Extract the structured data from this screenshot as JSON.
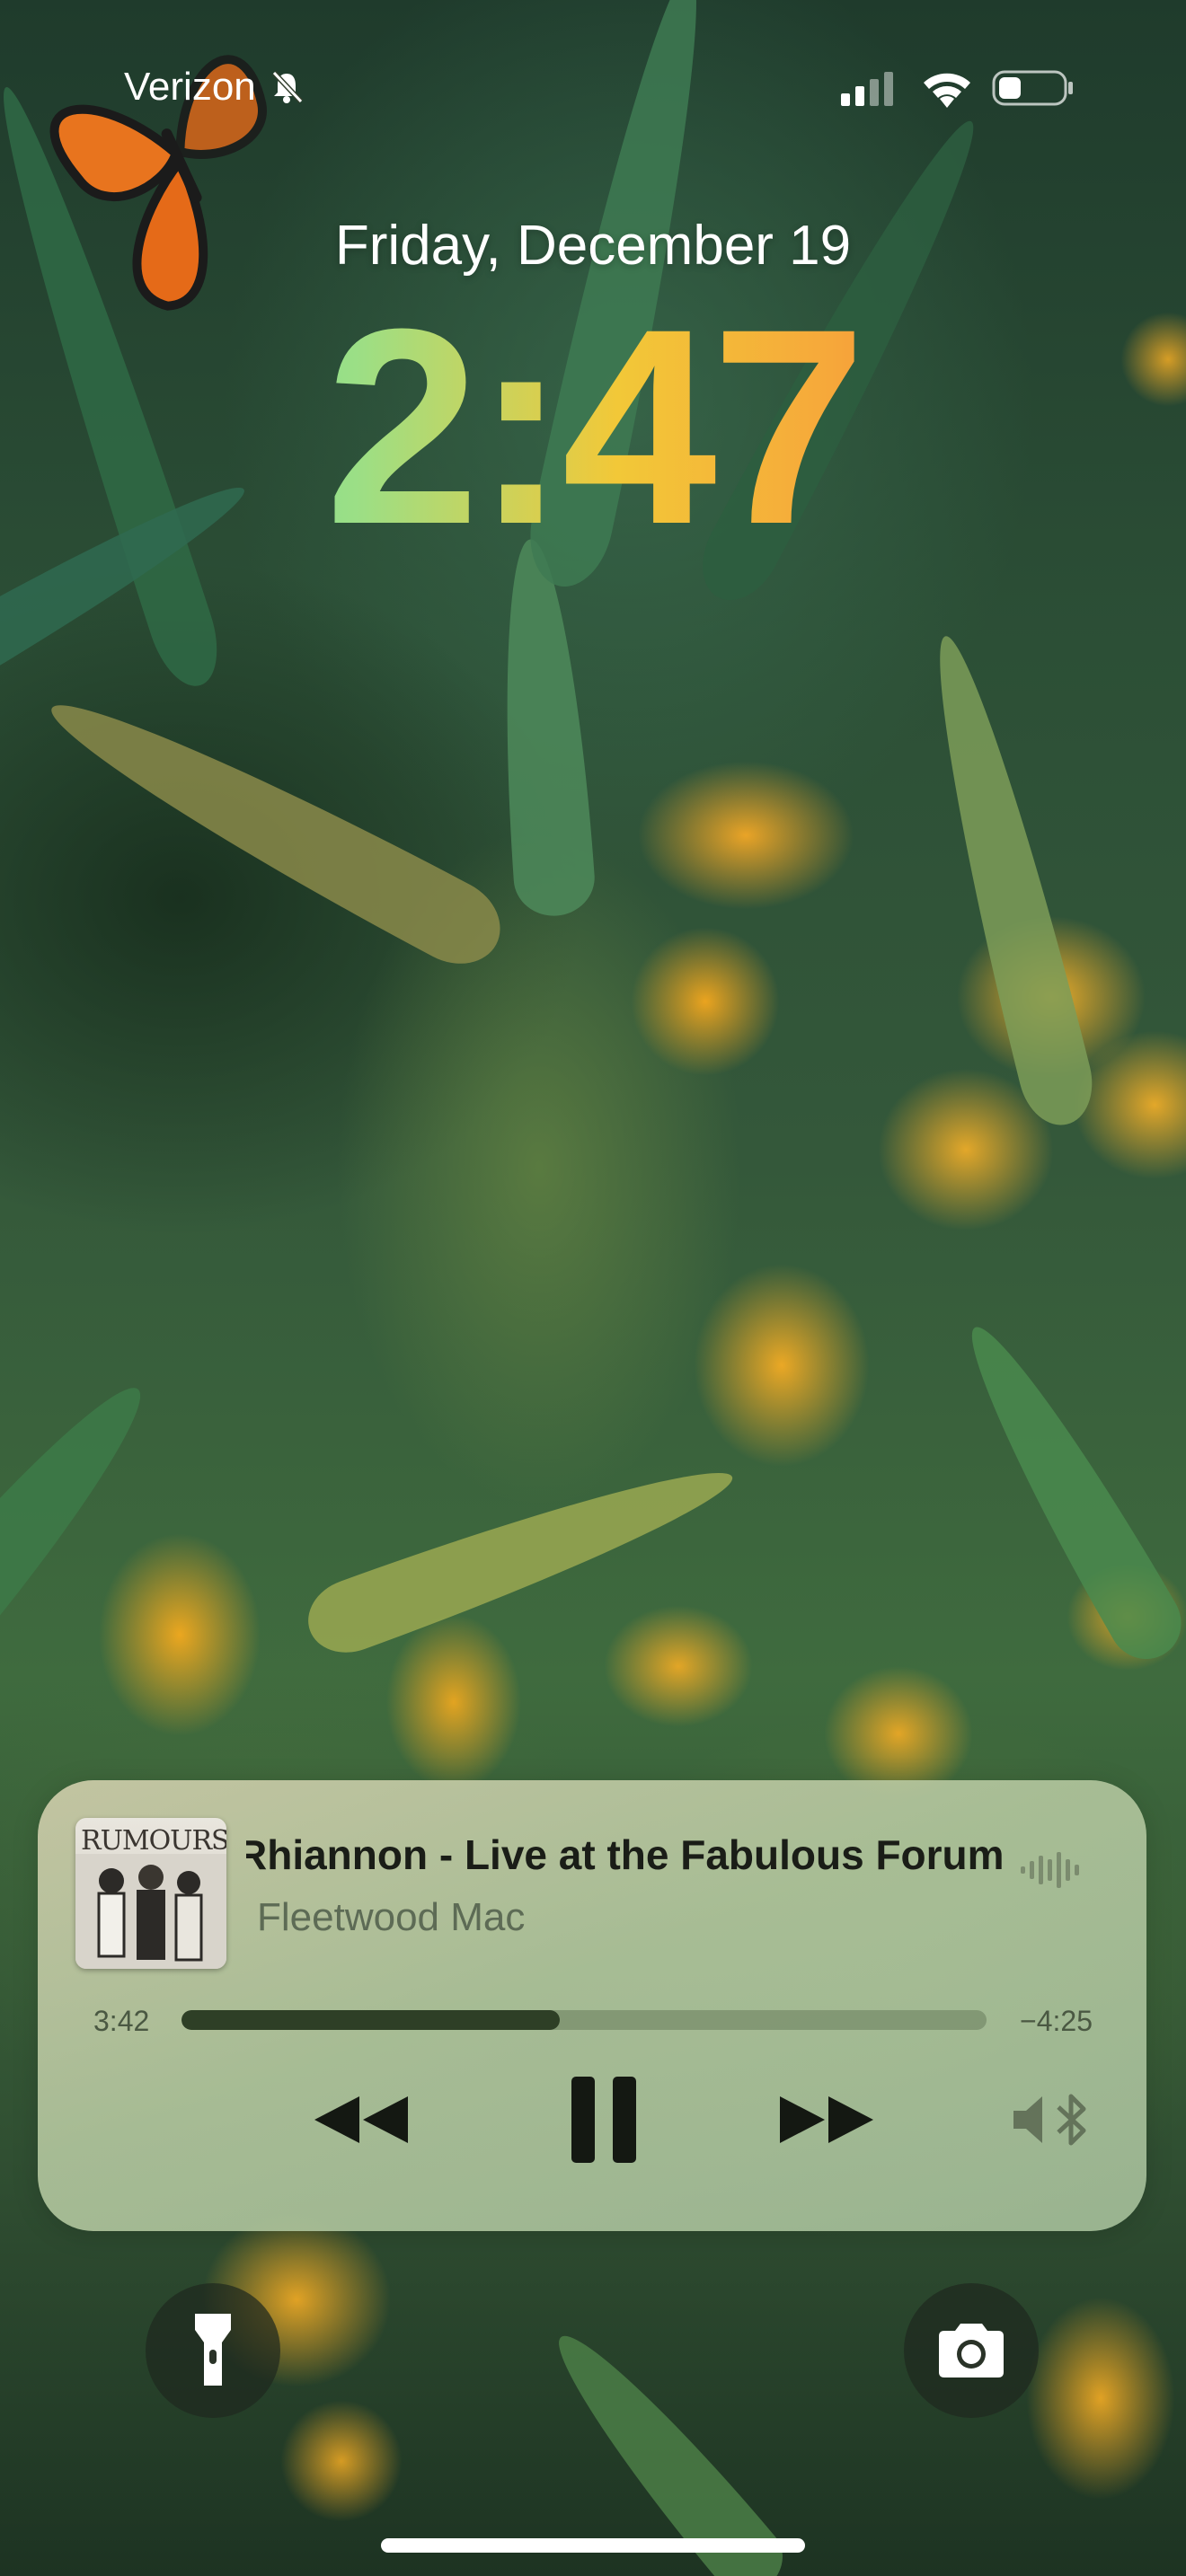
{
  "status_bar": {
    "carrier": "Verizon",
    "icons": [
      "bell-slash-icon",
      "cellular-signal-icon",
      "wifi-icon",
      "battery-icon"
    ]
  },
  "lock_screen": {
    "date": "Friday, December 19",
    "time": "2:47"
  },
  "now_playing": {
    "title": "Rhiannon - Live at the Fabulous Forum",
    "artist": "Fleetwood Mac",
    "artwork_text": "RUMOURS",
    "elapsed": "3:42",
    "remaining": "−4:25",
    "progress": 0.47,
    "controls": [
      "rewind-icon",
      "pause-icon",
      "fast-forward-icon",
      "speaker-bluetooth-icon"
    ]
  },
  "quick_actions": {
    "left": "flashlight-icon",
    "right": "camera-icon"
  },
  "colors": {
    "clock_gradient": [
      "#58d9a6",
      "#9bdf86",
      "#f2c838",
      "#f6a83a",
      "#f06b3c"
    ],
    "player_background": "#b7c49c",
    "progress_fill": "#2e3f26"
  }
}
